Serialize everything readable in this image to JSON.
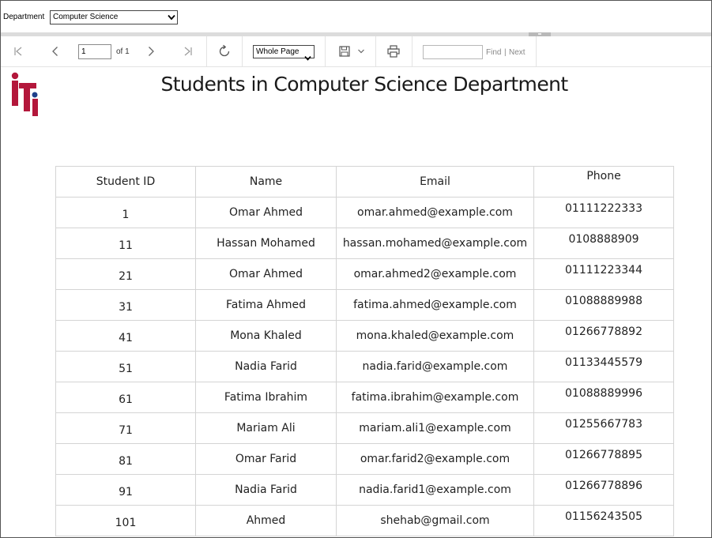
{
  "parameters": {
    "department_label": "Department",
    "department_value": "Computer Science"
  },
  "toolbar": {
    "current_page": "1",
    "page_of": "of 1",
    "zoom_value": "Whole Page",
    "find_label": "Find",
    "find_separator": "|",
    "next_label": "Next",
    "icons": [
      "first-page-icon",
      "previous-page-icon",
      "next-page-icon",
      "last-page-icon",
      "refresh-icon",
      "save-icon",
      "chevron-down-icon",
      "print-icon"
    ]
  },
  "report": {
    "title": "Students in Computer Science Department",
    "logo_colors": [
      "#b3173b",
      "#1f3f8a"
    ],
    "columns": [
      "Student ID",
      "Name",
      "Email",
      "Phone"
    ],
    "rows": [
      {
        "id": "1",
        "name": "Omar Ahmed",
        "email": "omar.ahmed@example.com",
        "phone": "01111222333"
      },
      {
        "id": "11",
        "name": "Hassan Mohamed",
        "email": "hassan.mohamed@example.com",
        "phone": "0108888909"
      },
      {
        "id": "21",
        "name": "Omar Ahmed",
        "email": "omar.ahmed2@example.com",
        "phone": "01111223344"
      },
      {
        "id": "31",
        "name": "Fatima Ahmed",
        "email": "fatima.ahmed@example.com",
        "phone": "01088889988"
      },
      {
        "id": "41",
        "name": "Mona Khaled",
        "email": "mona.khaled@example.com",
        "phone": "01266778892"
      },
      {
        "id": "51",
        "name": "Nadia Farid",
        "email": "nadia.farid@example.com",
        "phone": "01133445579"
      },
      {
        "id": "61",
        "name": "Fatima Ibrahim",
        "email": "fatima.ibrahim@example.com",
        "phone": "01088889996"
      },
      {
        "id": "71",
        "name": "Mariam Ali",
        "email": "mariam.ali1@example.com",
        "phone": "01255667783"
      },
      {
        "id": "81",
        "name": "Omar Farid",
        "email": "omar.farid2@example.com",
        "phone": "01266778895"
      },
      {
        "id": "91",
        "name": "Nadia Farid",
        "email": "nadia.farid1@example.com",
        "phone": "01266778896"
      },
      {
        "id": "101",
        "name": "Ahmed",
        "email": "shehab@gmail.com",
        "phone": "01156243505"
      }
    ]
  }
}
